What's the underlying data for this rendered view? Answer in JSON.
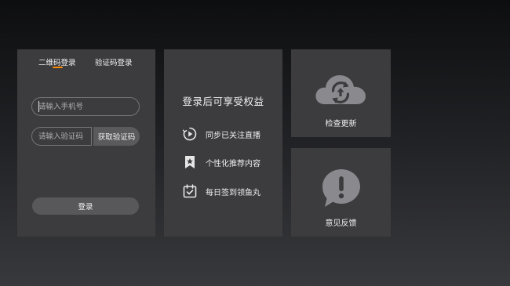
{
  "login": {
    "tabs": [
      {
        "label": "二维码登录",
        "active": true
      },
      {
        "label": "验证码登录",
        "active": false
      }
    ],
    "active_tab_color": "#ff8a00",
    "phone_placeholder": "请输入手机号",
    "code_placeholder": "请输入验证码",
    "get_code_label": "获取验证码",
    "login_label": "登录"
  },
  "benefits": {
    "title": "登录后可享受权益",
    "items": [
      {
        "icon": "play-sync-icon",
        "label": "同步已关注直播"
      },
      {
        "icon": "bookmark-star-icon",
        "label": "个性化推荐内容"
      },
      {
        "icon": "calendar-check-icon",
        "label": "每日签到领鱼丸"
      }
    ]
  },
  "tiles": {
    "update": {
      "icon": "cloud-refresh-icon",
      "label": "检查更新"
    },
    "feedback": {
      "icon": "exclamation-bubble-icon",
      "label": "意见反馈"
    }
  }
}
